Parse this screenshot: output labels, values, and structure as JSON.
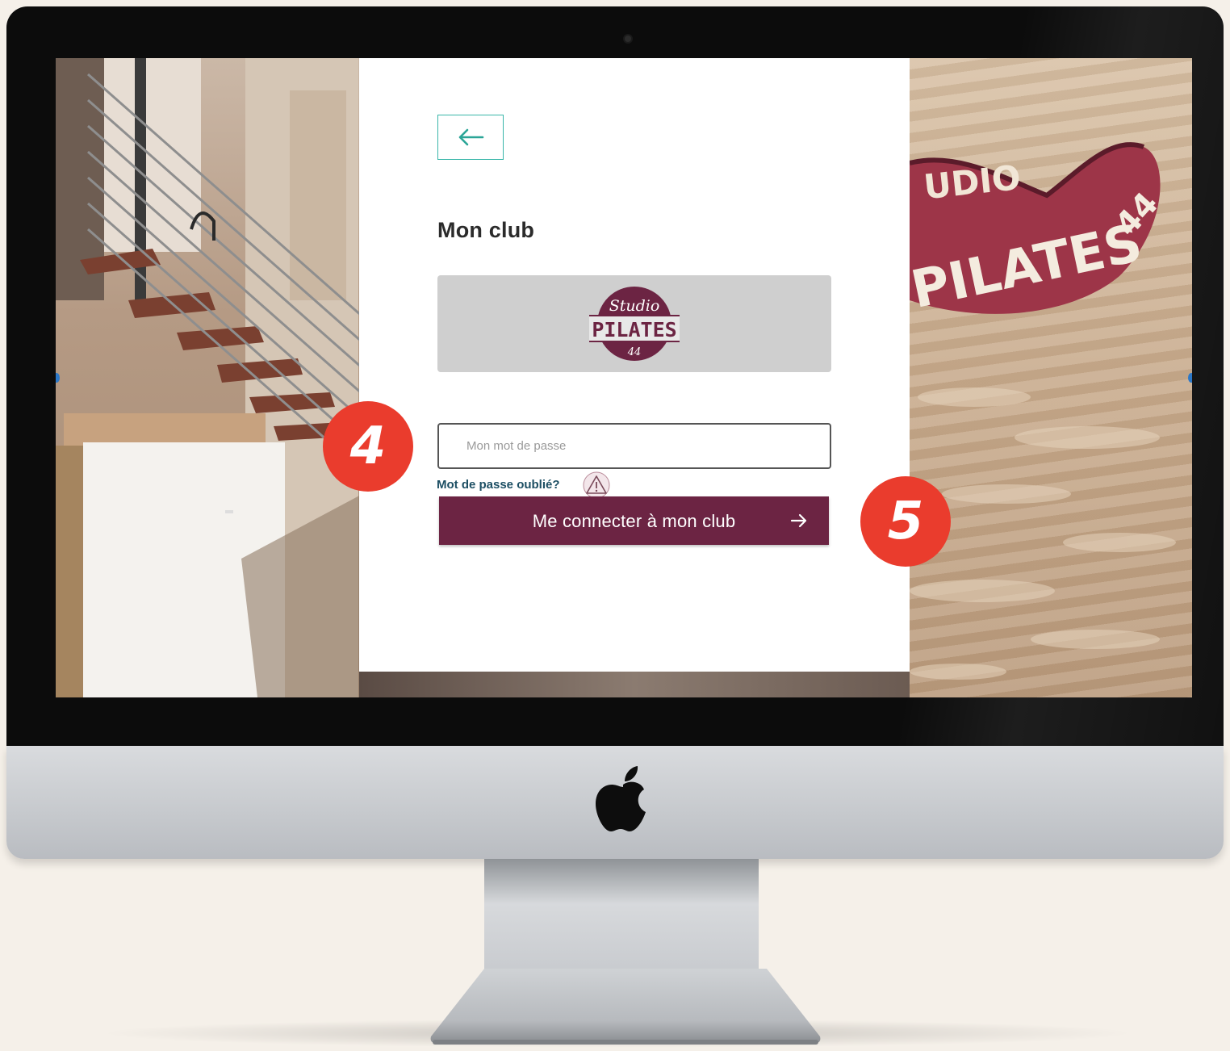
{
  "login": {
    "title": "Mon club",
    "password_placeholder": "Mon mot de passe",
    "forgot_password_label": "Mot de passe oublié?",
    "connect_button_label": "Me connecter à mon club"
  },
  "club_logo": {
    "line1": "Studio",
    "line2": "PILATES",
    "line3": "44"
  },
  "wall_sign": {
    "line1": "UDIO",
    "line2": "PILATES",
    "line3": "44"
  },
  "steps": {
    "password_step": "4",
    "connect_step": "5"
  },
  "icons": {
    "back": "arrow-left-icon",
    "warning": "warning-triangle-icon",
    "connect": "arrow-right-icon",
    "device": "apple-logo-icon"
  },
  "colors": {
    "primary": "#6c2443",
    "accent_teal": "#39b6a9",
    "link": "#1c4e63",
    "badge": "#ea3c2d",
    "logo_panel": "#cfcfcf"
  }
}
